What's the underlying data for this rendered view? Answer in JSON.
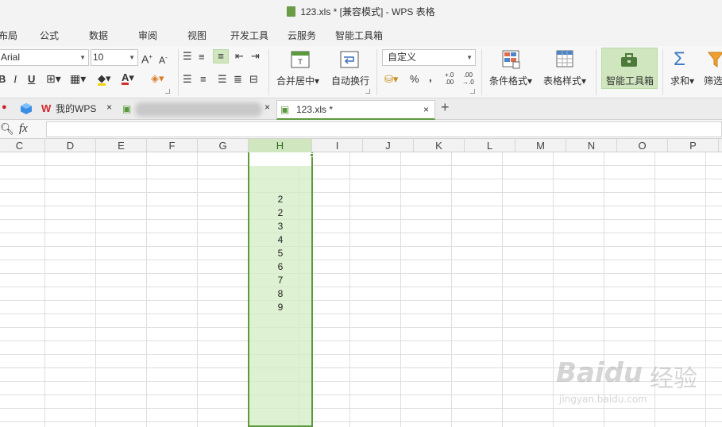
{
  "window": {
    "title": "123.xls * [兼容模式] - WPS 表格"
  },
  "menu": [
    "布局",
    "公式",
    "数据",
    "审阅",
    "视图",
    "开发工具",
    "云服务",
    "智能工具箱"
  ],
  "ribbon": {
    "font_name": "Arial",
    "font_size": "10",
    "number_format": "自定义",
    "merge_center": "合并居中",
    "auto_wrap": "自动换行",
    "conditional_format": "条件格式",
    "table_style": "表格样式",
    "smart_toolbox": "智能工具箱",
    "sum": "求和",
    "filter": "筛选",
    "bold": "B",
    "italic": "I",
    "underline": "U",
    "percent": "%",
    "comma": ","
  },
  "tabs": {
    "wps": "我的WPS",
    "file": "123.xls *",
    "new_tab": "+"
  },
  "formula_bar": {
    "fx": "fx",
    "value": ""
  },
  "columns": [
    "C",
    "D",
    "E",
    "F",
    "G",
    "H",
    "I",
    "J",
    "K",
    "L",
    "M",
    "N",
    "O",
    "P"
  ],
  "selected_column": "H",
  "cells_h": [
    "2",
    "2",
    "3",
    "4",
    "5",
    "6",
    "7",
    "8",
    "9"
  ],
  "watermark": {
    "brand": "Baidu",
    "brand_cn": "经验",
    "url": "jingyan.baidu.com"
  },
  "colors": {
    "accent": "#5b9a3c",
    "selection_fill": "#d3ecc4"
  }
}
